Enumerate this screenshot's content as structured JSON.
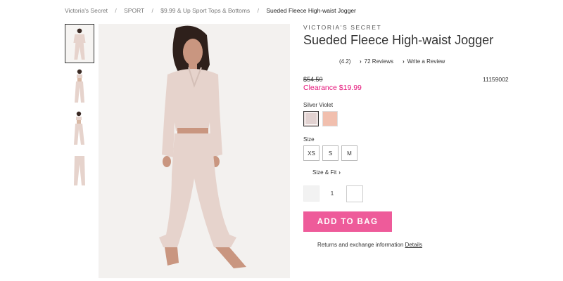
{
  "breadcrumb": [
    {
      "label": "Victoria's Secret"
    },
    {
      "label": "SPORT"
    },
    {
      "label": "$9.99 & Up Sport Tops & Bottoms"
    },
    {
      "label": "Sueded Fleece High-waist Jogger",
      "current": true
    }
  ],
  "breadcrumb_separator": "/",
  "product": {
    "brand": "VICTORIA'S SECRET",
    "title": "Sueded Fleece High-waist Jogger",
    "rating": "(4.2)",
    "reviews_link": "72 Reviews",
    "write_review": "Write a Review",
    "original_price": "$54.50",
    "sale_price": "Clearance $19.99",
    "sku": "11159002"
  },
  "color": {
    "label": "Silver Violet",
    "swatches": [
      {
        "name": "Silver Violet",
        "hex": "#e2d2d1",
        "selected": true
      },
      {
        "name": "Peach",
        "hex": "#f1bfae",
        "selected": false
      }
    ]
  },
  "size": {
    "label": "Size",
    "options": [
      "XS",
      "S",
      "M"
    ],
    "size_fit": "Size & Fit"
  },
  "quantity": {
    "value": "1"
  },
  "actions": {
    "add_to_bag": "ADD TO BAG"
  },
  "returns": {
    "text": "Returns and exchange information",
    "link": "Details"
  },
  "colors": {
    "accent_pink": "#ee5b9a",
    "sale_pink": "#e5157a",
    "image_bg": "#f3f1ef",
    "garment": "#e6d3cc"
  },
  "icons": {
    "chevron": "chevron-right-icon",
    "minus": "minus-icon",
    "plus": "plus-icon"
  }
}
